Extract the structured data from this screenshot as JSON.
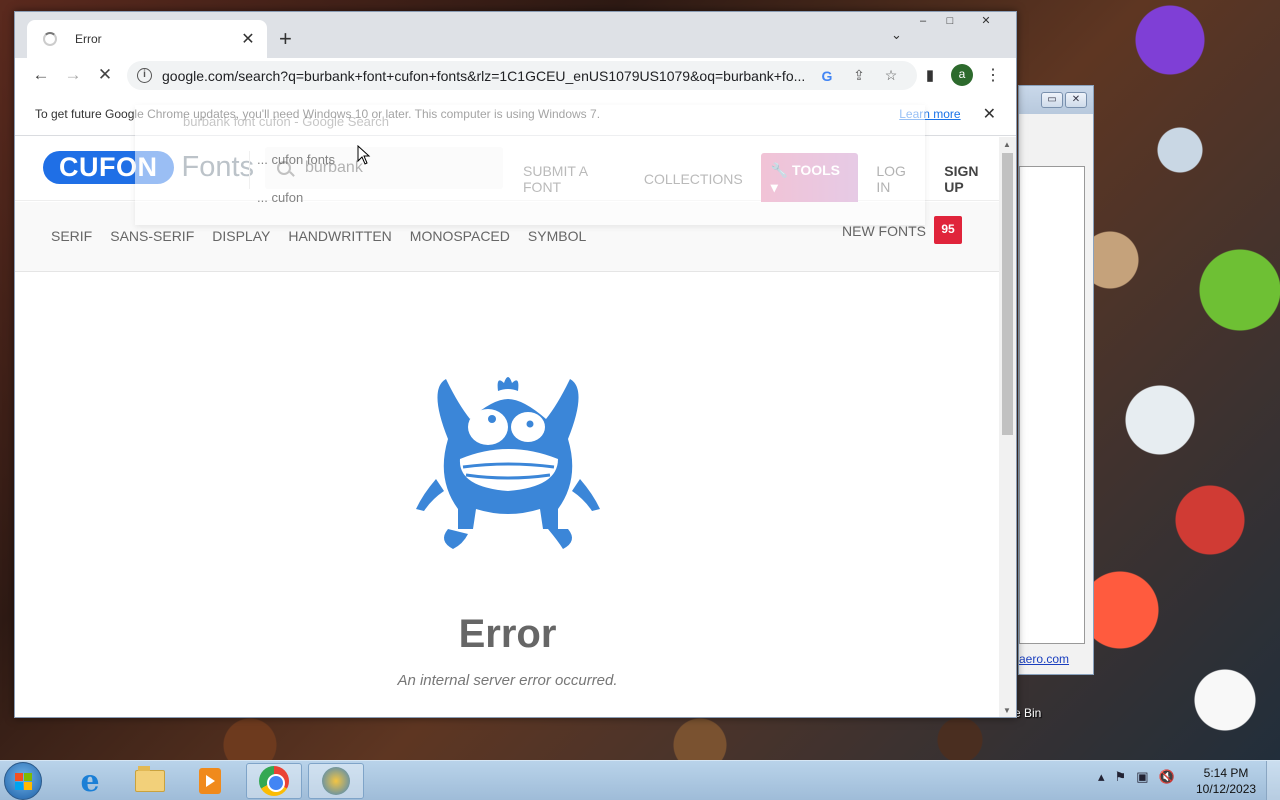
{
  "background_window": {
    "link_text": "aero.com",
    "desktop_icon_label": "e Bin"
  },
  "browser": {
    "tab": {
      "title": "Error"
    },
    "window_controls": {
      "minimize": "–",
      "restore": "□",
      "close": "✕"
    },
    "url": "google.com/search?q=burbank+font+cufon+fonts&rlz=1C1GCEU_enUS1079US1079&oq=burbank+fo...",
    "profile_initial": "a",
    "infobar": {
      "message": "To get future Google Chrome updates, you'll need Windows 10 or later. This computer is using Windows 7.",
      "learn_more": "Learn more"
    },
    "autocomplete_ghost": {
      "item1": "burbank font cufon - Google Search",
      "item2": "... cufon fonts",
      "item3": "... cufon"
    }
  },
  "site": {
    "logo_pill": "CUFON",
    "logo_word": "Fonts",
    "search_value": "burbank",
    "nav": {
      "submit": "SUBMIT A FONT",
      "collections": "COLLECTIONS",
      "tools": "TOOLS",
      "login": "LOG IN",
      "signup": "SIGN UP"
    },
    "categories": [
      "SERIF",
      "SANS-SERIF",
      "DISPLAY",
      "HANDWRITTEN",
      "MONOSPACED",
      "SYMBOL"
    ],
    "new_fonts_label": "NEW FONTS",
    "new_fonts_count": "95",
    "error": {
      "title": "Error",
      "message": "An internal server error occurred."
    },
    "colors": {
      "brand_blue": "#1f6fe6",
      "monster_blue": "#3b86d8",
      "badge_red": "#e0243b"
    }
  },
  "taskbar": {
    "clock_time": "5:14 PM",
    "clock_date": "10/12/2023"
  }
}
